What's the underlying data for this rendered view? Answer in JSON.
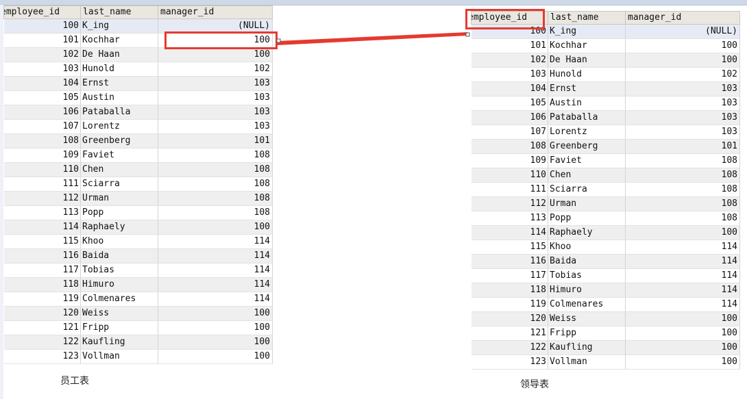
{
  "columns": [
    "employee_id",
    "last_name",
    "manager_id"
  ],
  "left_caption": "员工表",
  "right_caption": "领导表",
  "rows": [
    {
      "id": "100",
      "name": "K_ing",
      "mgr": "(NULL)"
    },
    {
      "id": "101",
      "name": "Kochhar",
      "mgr": "100"
    },
    {
      "id": "102",
      "name": "De Haan",
      "mgr": "100"
    },
    {
      "id": "103",
      "name": "Hunold",
      "mgr": "102"
    },
    {
      "id": "104",
      "name": "Ernst",
      "mgr": "103"
    },
    {
      "id": "105",
      "name": "Austin",
      "mgr": "103"
    },
    {
      "id": "106",
      "name": "Pataballa",
      "mgr": "103"
    },
    {
      "id": "107",
      "name": "Lorentz",
      "mgr": "103"
    },
    {
      "id": "108",
      "name": "Greenberg",
      "mgr": "101"
    },
    {
      "id": "109",
      "name": "Faviet",
      "mgr": "108"
    },
    {
      "id": "110",
      "name": "Chen",
      "mgr": "108"
    },
    {
      "id": "111",
      "name": "Sciarra",
      "mgr": "108"
    },
    {
      "id": "112",
      "name": "Urman",
      "mgr": "108"
    },
    {
      "id": "113",
      "name": "Popp",
      "mgr": "108"
    },
    {
      "id": "114",
      "name": "Raphaely",
      "mgr": "100"
    },
    {
      "id": "115",
      "name": "Khoo",
      "mgr": "114"
    },
    {
      "id": "116",
      "name": "Baida",
      "mgr": "114"
    },
    {
      "id": "117",
      "name": "Tobias",
      "mgr": "114"
    },
    {
      "id": "118",
      "name": "Himuro",
      "mgr": "114"
    },
    {
      "id": "119",
      "name": "Colmenares",
      "mgr": "114"
    },
    {
      "id": "120",
      "name": "Weiss",
      "mgr": "100"
    },
    {
      "id": "121",
      "name": "Fripp",
      "mgr": "100"
    },
    {
      "id": "122",
      "name": "Kaufling",
      "mgr": "100"
    },
    {
      "id": "123",
      "name": "Vollman",
      "mgr": "100"
    }
  ],
  "colors": {
    "highlight": "#e53a2f",
    "header_bg": "#e9e7df",
    "alt_row_bg": "#efefef"
  }
}
